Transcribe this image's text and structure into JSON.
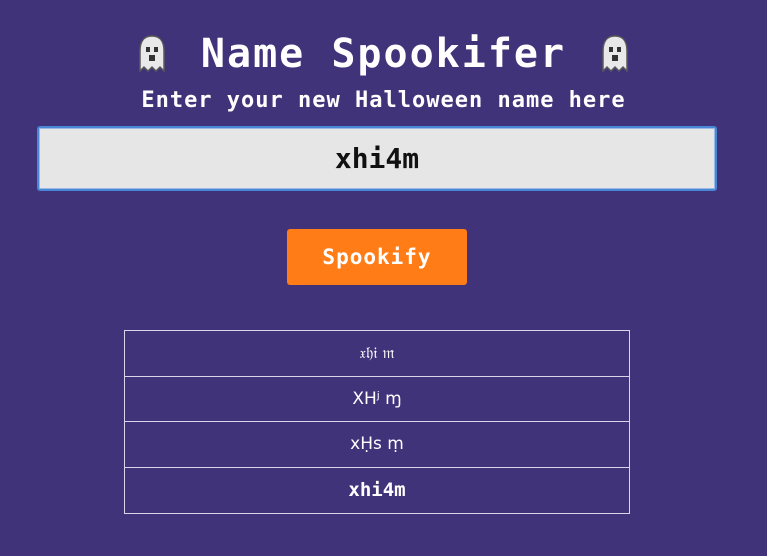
{
  "header": {
    "title": "Name Spookifer",
    "subtitle": "Enter your new Halloween name here",
    "left_icon": "ghost-icon",
    "right_icon": "ghost-icon"
  },
  "name_input": {
    "value": "xhi4m"
  },
  "spookify_button": {
    "label": "Spookify"
  },
  "results": [
    {
      "text": "𝔵𝔥𝔦 𝔪"
    },
    {
      "text": "ХНʲ ɱ"
    },
    {
      "text": "xḤꜱ ṃ"
    },
    {
      "text": "xhi4m"
    }
  ],
  "colors": {
    "background": "#41337a",
    "button": "#ff7c17",
    "input_background": "#e6e6e6",
    "input_border": "#4a86d6",
    "text": "#ffffff"
  }
}
